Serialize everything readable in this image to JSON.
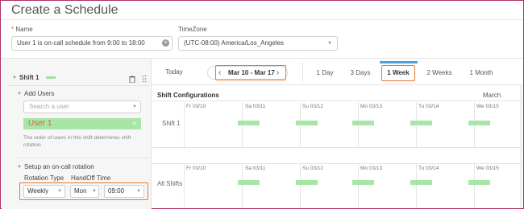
{
  "page": {
    "title": "Create a Schedule"
  },
  "form": {
    "name_label": "Name",
    "name_required": "*",
    "name_value": "User 1 is on-call schedule from 9:00 to 18:00",
    "timezone_label": "TimeZone",
    "timezone_value": "(UTC-08:00) America/Los_Angeles"
  },
  "sidebar": {
    "shift_title": "Shift 1",
    "add_users_label": "Add Users",
    "search_placeholder": "Search a user",
    "user_tag": "User 1",
    "order_note_line1": "The order of users in this shift determines shift",
    "order_note_line2": "rotation",
    "rotation_section": "Setup an on-call rotation",
    "rotation_type_label": "Rotation Type",
    "handoff_label": "HandOff Time",
    "rotation_type_value": "Weekly",
    "handoff_day": "Mon",
    "handoff_time": "09:00"
  },
  "toolbar": {
    "today": "Today",
    "date_range": "Mar 10 - Mar 17",
    "views": [
      "1 Day",
      "3 Days",
      "1 Week",
      "2 Weeks",
      "1 Month"
    ],
    "active_view": "1 Week"
  },
  "calendar": {
    "heading": "Shift Configurations",
    "month": "March",
    "days": [
      "Fr 03/10",
      "Sa 03/11",
      "Su 03/12",
      "Mo 03/13",
      "Tu 03/14",
      "We 03/15"
    ],
    "rows": [
      "Shift 1",
      "All Shifts"
    ]
  },
  "colors": {
    "accent": "#4aa3df",
    "highlight": "#e8792b",
    "shift_green": "#9fe09f",
    "tag_text": "#e8613c"
  }
}
